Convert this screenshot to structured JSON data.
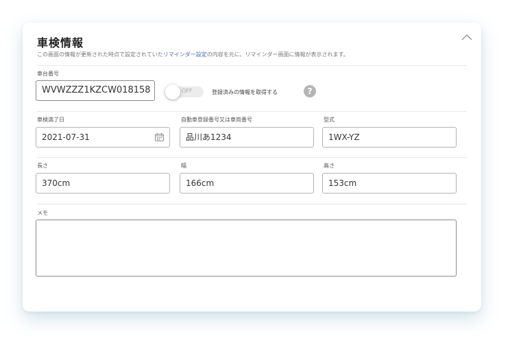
{
  "section": {
    "title": "車検情報",
    "description_before": "この画面の情報が更新された時点で設定されていた",
    "description_link": "リマインダー設定",
    "description_after": "の内容を元に、リマインダー画面に情報が表示されます。"
  },
  "icons": {
    "collapse": "chevron-up-icon",
    "calendar": "calendar-icon",
    "help": "question-mark-icon"
  },
  "chassis": {
    "label": "車台番号",
    "value": "WVWZZZ1KZCW018158"
  },
  "toggle": {
    "state_text": "OFF",
    "label": "登録済みの情報を取得する",
    "help_glyph": "?"
  },
  "inspection_expiry": {
    "label": "車検満了日",
    "value": "2021-07-31"
  },
  "registration_number": {
    "label": "自動車登録番号又は車両番号",
    "value": "品川あ1234"
  },
  "model": {
    "label": "型式",
    "value": "1WX-YZ"
  },
  "length": {
    "label": "長さ",
    "value": "370cm"
  },
  "width": {
    "label": "幅",
    "value": "166cm"
  },
  "height": {
    "label": "高さ",
    "value": "153cm"
  },
  "memo": {
    "label": "メモ",
    "value": ""
  },
  "colors": {
    "link": "#4a67b8",
    "shadow": "#5698b2",
    "border": "#b3b3b3"
  }
}
